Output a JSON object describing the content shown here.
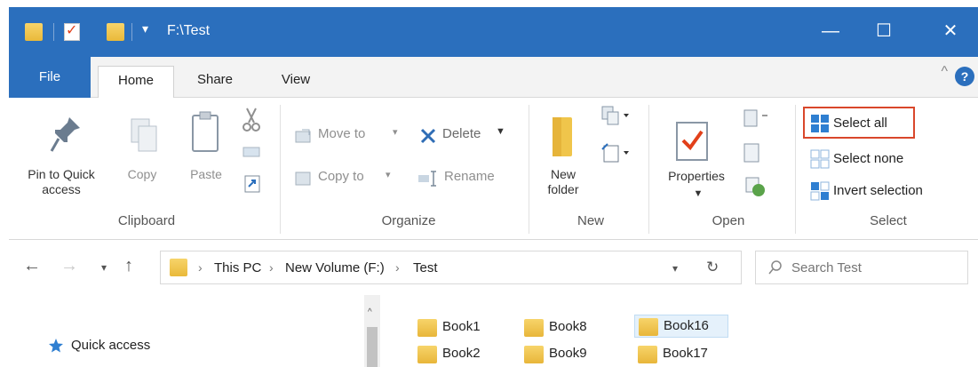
{
  "titlebar": {
    "title": "F:\\Test",
    "minimize_glyph": "—",
    "maximize_glyph": "☐",
    "close_glyph": "✕",
    "dropdown_glyph": "▾"
  },
  "tabs": {
    "file": "File",
    "home": "Home",
    "share": "Share",
    "view": "View",
    "help_glyph": "?",
    "collapse_glyph": "^"
  },
  "ribbon": {
    "clipboard": {
      "pin_label": "Pin to Quick access",
      "copy_label": "Copy",
      "paste_label": "Paste",
      "group_label": "Clipboard"
    },
    "organize": {
      "move_to": "Move to",
      "copy_to": "Copy to",
      "delete": "Delete",
      "rename": "Rename",
      "group_label": "Organize"
    },
    "new": {
      "new_folder_label": "New folder",
      "group_label": "New"
    },
    "open": {
      "properties_label": "Properties",
      "group_label": "Open"
    },
    "select": {
      "select_all": "Select all",
      "select_none": "Select none",
      "invert_selection": "Invert selection",
      "group_label": "Select"
    }
  },
  "address": {
    "crumbs": [
      "This PC",
      "New Volume (F:)",
      "Test"
    ],
    "search_placeholder": "Search Test"
  },
  "nav_pane": {
    "quick_access": "Quick access"
  },
  "files": [
    {
      "name": "Book1"
    },
    {
      "name": "Book2"
    },
    {
      "name": "Book8"
    },
    {
      "name": "Book9"
    },
    {
      "name": "Book16"
    },
    {
      "name": "Book17"
    }
  ],
  "colors": {
    "accent": "#2b6fbd",
    "highlight_box": "#d9472b",
    "folder": "#f0c54b"
  }
}
